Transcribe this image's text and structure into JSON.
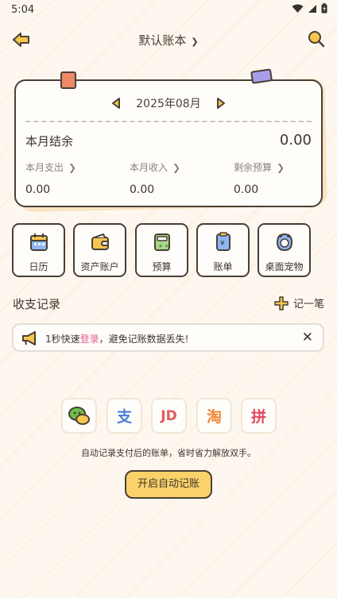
{
  "status_bar": {
    "time": "5:04"
  },
  "header": {
    "ledger_name": "默认账本"
  },
  "summary": {
    "month": "2025年08月",
    "balance_label": "本月结余",
    "balance_value": "0.00",
    "stats": [
      {
        "label": "本月支出",
        "value": "0.00"
      },
      {
        "label": "本月收入",
        "value": "0.00"
      },
      {
        "label": "剩余预算",
        "value": "0.00"
      }
    ]
  },
  "quick_tiles": [
    {
      "label": "日历",
      "icon": "calendar-icon"
    },
    {
      "label": "资产账户",
      "icon": "wallet-icon"
    },
    {
      "label": "预算",
      "icon": "calculator-icon"
    },
    {
      "label": "账单",
      "icon": "bill-icon"
    },
    {
      "label": "桌面宠物",
      "icon": "pet-icon"
    }
  ],
  "records": {
    "title": "收支记录",
    "add_label": "记一笔"
  },
  "notice": {
    "prefix": "1秒快速",
    "link": "登录",
    "suffix": "，避免记账数据丢失!",
    "close": "✕"
  },
  "auto_record": {
    "apps": [
      {
        "icon": "wechat-icon",
        "glyph": ""
      },
      {
        "icon": "alipay-icon",
        "glyph": "支"
      },
      {
        "icon": "jd-icon",
        "glyph": "JD"
      },
      {
        "icon": "taobao-icon",
        "glyph": "淘"
      },
      {
        "icon": "pinduoduo-icon",
        "glyph": "拼"
      }
    ],
    "description": "自动记录支付后的账单，省时省力解放双手。",
    "button_label": "开启自动记账"
  },
  "colors": {
    "accent_yellow": "#fbd26a",
    "outline": "#4a3f35",
    "link_pink": "#e25c8c",
    "alipay_blue": "#4a7fd6",
    "jd_red": "#e05b5b",
    "taobao_orange": "#f08a3c",
    "pdd_red": "#e0475b",
    "wechat_green": "#6cc04a"
  }
}
